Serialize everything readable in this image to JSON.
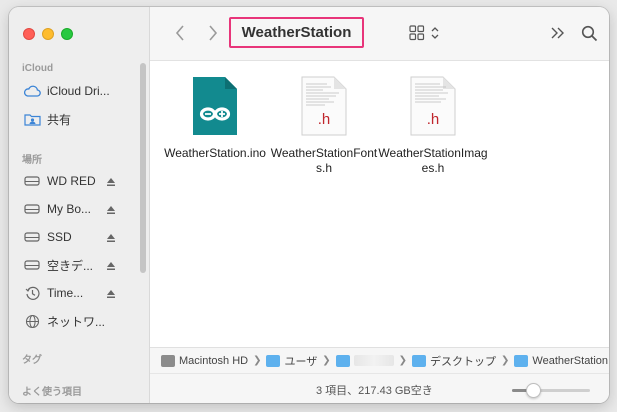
{
  "window": {
    "title": "WeatherStation",
    "accent_highlight": "#e8357a"
  },
  "sidebar": {
    "sections": [
      {
        "heading": "iCloud",
        "items": [
          {
            "label": "iCloud Dri...",
            "icon": "cloud-icon"
          },
          {
            "label": "共有",
            "icon": "shared-folder-icon"
          }
        ]
      },
      {
        "heading": "場所",
        "items": [
          {
            "label": "WD RED",
            "icon": "drive-icon",
            "eject": true
          },
          {
            "label": "My Bo...",
            "icon": "drive-icon",
            "eject": true
          },
          {
            "label": "SSD",
            "icon": "drive-icon",
            "eject": true
          },
          {
            "label": "空きデ...",
            "icon": "drive-icon",
            "eject": true
          },
          {
            "label": "Time...",
            "icon": "time-machine-icon",
            "eject": true
          },
          {
            "label": "ネットワ...",
            "icon": "network-icon"
          }
        ]
      },
      {
        "heading": "タグ",
        "items": []
      },
      {
        "heading": "よく使う項目",
        "items": []
      }
    ]
  },
  "files": [
    {
      "name": "WeatherStation.ino",
      "type": "arduino",
      "badge": ""
    },
    {
      "name": "WeatherStationFonts.h",
      "type": "header",
      "badge": ".h"
    },
    {
      "name": "WeatherStationImages.h",
      "type": "header",
      "badge": ".h"
    }
  ],
  "path": [
    {
      "label": "Macintosh HD",
      "icon": "hard-disk-icon"
    },
    {
      "label": "ユーザ",
      "icon": "folder-icon"
    },
    {
      "label": "",
      "icon": "home-folder-icon"
    },
    {
      "label": "デスクトップ",
      "icon": "folder-icon"
    },
    {
      "label": "WeatherStation",
      "icon": "folder-icon"
    }
  ],
  "status": {
    "text": "3 項目、217.43 GB空き",
    "zoom_level": 0.28
  }
}
